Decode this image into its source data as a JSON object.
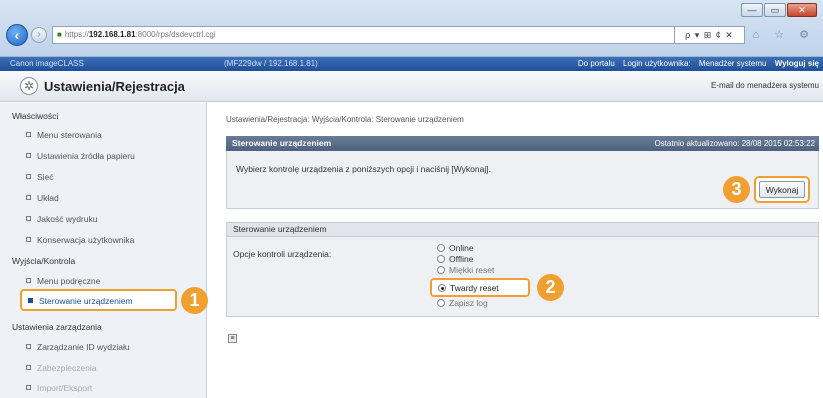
{
  "browser": {
    "url_prefix": "https://",
    "url_host": "192.168.1.81",
    "url_rest": ":8000/rps/dsdevctrl.cgi",
    "toolbar_glyphs": "ρ ▾ ⊞ ¢ ✕",
    "win_minimize": "—",
    "win_restore": "▭",
    "win_close": "✕",
    "top_icons": "⌂ ☆ ⚙"
  },
  "topbar": {
    "device_name": "Canon imageCLASS",
    "device_name_2": "(MF229dw / 192.168.1.81)",
    "portal_link": "Do portalu",
    "login_label": "Login użytkownika:",
    "user": "Menadżer systemu",
    "logout": "Wyloguj się"
  },
  "header": {
    "title": "Ustawienia/Rejestracja",
    "email_link": "E-mail do menadżera systemu"
  },
  "sidebar": {
    "group1": "Właściwości",
    "items1": [
      "Menu sterowania",
      "Ustawienia źródła papieru",
      "Sieć",
      "Układ",
      "Jakość wydruku",
      "Konserwacja użytkownika"
    ],
    "group2": "Wyjścia/Kontrola",
    "items2": [
      "Menu podręczne",
      "Sterowanie urządzeniem"
    ],
    "group3": "Ustawienia zarządzania",
    "items3": [
      "Zarządzanie ID wydziału",
      "Zabezpieczenia",
      "Import/Eksport"
    ]
  },
  "main": {
    "breadcrumb": "Ustawienia/Rejestracja: Wyjścia/Kontrola: Sterowanie urządzeniem",
    "panel_title": "Sterowanie urządzeniem",
    "last_updated": "Ostatnio aktualizowano: 28/08 2015 02:53:22",
    "instruction": "Wybierz kontrolę urządzenia z poniższych opcji i naciśnij [Wykonaj].",
    "execute_button": "Wykonaj",
    "section_title": "Sterowanie urządzeniem",
    "options_label": "Opcje kontroli urządzenia:",
    "options": [
      "Online",
      "Offline",
      "Miękki reset",
      "Twardy reset",
      "Zapisz log"
    ],
    "selected_option": "Twardy reset"
  },
  "callouts": [
    "1",
    "2",
    "3"
  ],
  "colors": {
    "callout": "#f0a030",
    "topbar": "#1e4f98",
    "panel_header": "#4d6280"
  }
}
